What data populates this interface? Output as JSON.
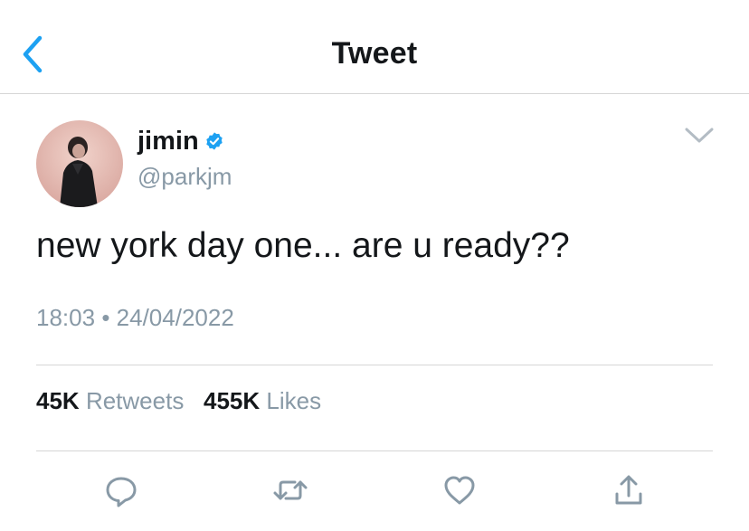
{
  "header": {
    "title": "Tweet",
    "back_icon": "chevron-left-icon",
    "accent_color": "#1da1f2"
  },
  "author": {
    "display_name": "jimin",
    "handle": "@parkjm",
    "verified": true,
    "verified_icon": "verified-badge-icon"
  },
  "tweet": {
    "text": "new york day one... are u ready??",
    "time": "18:03",
    "separator": "•",
    "date": "24/04/2022"
  },
  "stats": {
    "retweets_count": "45K",
    "retweets_label": "Retweets",
    "likes_count": "455K",
    "likes_label": "Likes"
  },
  "actions": {
    "reply_icon": "reply-icon",
    "retweet_icon": "retweet-icon",
    "like_icon": "heart-icon",
    "share_icon": "share-icon"
  },
  "colors": {
    "text_primary": "#14171a",
    "text_secondary": "#8899a6",
    "divider": "#d6d6d6"
  }
}
